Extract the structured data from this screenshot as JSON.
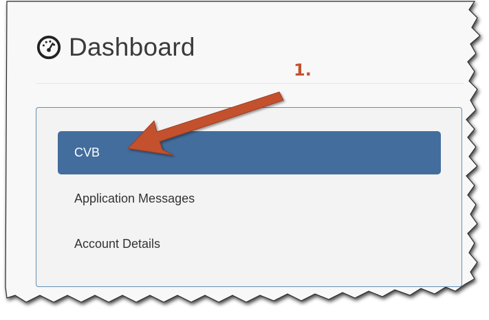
{
  "header": {
    "title": "Dashboard",
    "icon": "speedometer-icon"
  },
  "nav": {
    "items": [
      {
        "label": "CVB",
        "active": true
      },
      {
        "label": "Application Messages",
        "active": false
      },
      {
        "label": "Account Details",
        "active": false
      }
    ]
  },
  "annotation": {
    "label": "1.",
    "color": "#c4512f"
  },
  "colors": {
    "active_bg": "#436d9c",
    "panel_border": "#5e8fb4",
    "panel_bg": "#f3f3f3"
  }
}
